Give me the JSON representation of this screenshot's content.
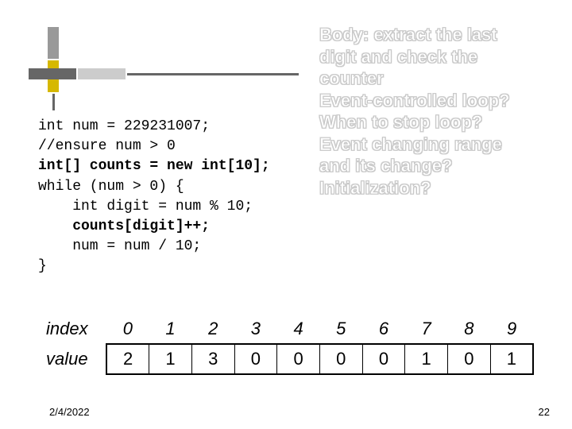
{
  "code": {
    "line1": "int num = 229231007;",
    "line2": "//ensure num > 0",
    "line3": "int[] counts = new int[10];",
    "line4": "while (num > 0) {",
    "line5": "    int digit = num % 10;",
    "line6": "    counts[digit]++;",
    "line7": "    num = num / 10;",
    "line8": "}"
  },
  "annotations": {
    "l1": "Body: extract the last",
    "l2": "digit and check the",
    "l3": "counter",
    "l4": "Event-controlled loop?",
    "l5": "When to stop loop?",
    "l6": "Event  changing range",
    "l7": "and its change?",
    "l8": "Initialization?"
  },
  "array": {
    "index_label": "index",
    "value_label": "value",
    "indices": [
      "0",
      "1",
      "2",
      "3",
      "4",
      "5",
      "6",
      "7",
      "8",
      "9"
    ],
    "values": [
      "2",
      "1",
      "3",
      "0",
      "0",
      "0",
      "0",
      "1",
      "0",
      "1"
    ]
  },
  "footer": {
    "date": "2/4/2022",
    "page": "22"
  }
}
